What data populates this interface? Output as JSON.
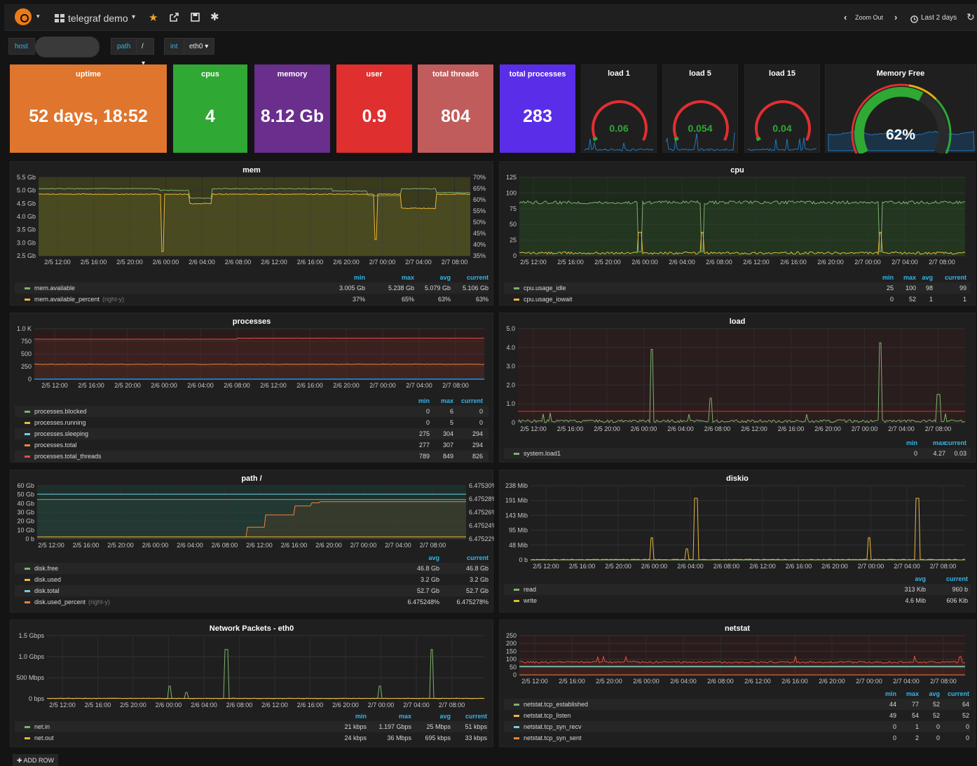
{
  "nav": {
    "dashboard_title": "telegraf demo",
    "zoom_out": "Zoom Out",
    "time_range": "Last 2 days"
  },
  "vars": [
    {
      "label": "host",
      "value": ""
    },
    {
      "label": "path",
      "value": "/"
    },
    {
      "label": "int",
      "value": "eth0"
    }
  ],
  "stats": [
    {
      "title": "uptime",
      "value": "52 days, 18:52",
      "color": "#e0752d"
    },
    {
      "title": "cpus",
      "value": "4",
      "color": "#2fa834"
    },
    {
      "title": "memory",
      "value": "8.12 Gb",
      "color": "#6a2e8c"
    },
    {
      "title": "user",
      "value": "0.9",
      "color": "#e02f2f"
    },
    {
      "title": "total threads",
      "value": "804",
      "color": "#c15c5c"
    },
    {
      "title": "total processes",
      "value": "283",
      "color": "#5a2ee8"
    }
  ],
  "gauges": [
    {
      "title": "load 1",
      "value": "0.06"
    },
    {
      "title": "load 5",
      "value": "0.054"
    },
    {
      "title": "load 15",
      "value": "0.04"
    },
    {
      "title": "Memory Free",
      "value": "62%"
    }
  ],
  "time_ticks": [
    "2/5 12:00",
    "2/5 16:00",
    "2/5 20:00",
    "2/6 00:00",
    "2/6 04:00",
    "2/6 08:00",
    "2/6 12:00",
    "2/6 16:00",
    "2/6 20:00",
    "2/7 00:00",
    "2/7 04:00",
    "2/7 08:00"
  ],
  "mem": {
    "title": "mem",
    "yleft": [
      "5.5 Gb",
      "5.0 Gb",
      "4.5 Gb",
      "4.0 Gb",
      "3.5 Gb",
      "3.0 Gb",
      "2.5 Gb"
    ],
    "yright": [
      "70%",
      "65%",
      "60%",
      "55%",
      "50%",
      "45%",
      "40%",
      "35%"
    ],
    "headers": [
      "min",
      "max",
      "avg",
      "current"
    ],
    "rows": [
      {
        "name": "mem.available",
        "extra": "",
        "color": "#7eb26d",
        "vals": [
          "3.005 Gb",
          "5.238 Gb",
          "5.079 Gb",
          "5.106 Gb"
        ]
      },
      {
        "name": "mem.available_percent",
        "extra": "(right-y)",
        "color": "#eab839",
        "vals": [
          "37%",
          "65%",
          "63%",
          "63%"
        ]
      }
    ]
  },
  "cpu": {
    "title": "cpu",
    "yleft": [
      "125",
      "100",
      "75",
      "50",
      "25",
      "0"
    ],
    "headers": [
      "min",
      "max",
      "avg",
      "current"
    ],
    "rows": [
      {
        "name": "cpu.usage_idle",
        "color": "#7eb26d",
        "vals": [
          "25",
          "100",
          "98",
          "99"
        ]
      },
      {
        "name": "cpu.usage_iowait",
        "color": "#eab839",
        "vals": [
          "0",
          "52",
          "1",
          "1"
        ]
      }
    ]
  },
  "processes": {
    "title": "processes",
    "yleft": [
      "1.0 K",
      "750",
      "500",
      "250",
      "0"
    ],
    "headers": [
      "min",
      "max",
      "current"
    ],
    "rows": [
      {
        "name": "processes.blocked",
        "color": "#7eb26d",
        "vals": [
          "0",
          "6",
          "0"
        ]
      },
      {
        "name": "processes.running",
        "color": "#eab839",
        "vals": [
          "0",
          "5",
          "0"
        ]
      },
      {
        "name": "processes.sleeping",
        "color": "#6ed0e0",
        "vals": [
          "275",
          "304",
          "294"
        ]
      },
      {
        "name": "processes.total",
        "color": "#ef843c",
        "vals": [
          "277",
          "307",
          "294"
        ]
      },
      {
        "name": "processes.total_threads",
        "color": "#e24d42",
        "vals": [
          "789",
          "849",
          "826"
        ]
      }
    ]
  },
  "load": {
    "title": "load",
    "yleft": [
      "5.0",
      "4.0",
      "3.0",
      "2.0",
      "1.0",
      "0"
    ],
    "headers": [
      "min",
      "max",
      "current"
    ],
    "rows": [
      {
        "name": "system.load1",
        "color": "#7eb26d",
        "vals": [
          "0",
          "4.27",
          "0.03"
        ]
      }
    ]
  },
  "path": {
    "title": "path /",
    "yleft": [
      "60 Gb",
      "50 Gb",
      "40 Gb",
      "30 Gb",
      "20 Gb",
      "10 Gb",
      "0 b"
    ],
    "yright": [
      "6.47530%",
      "6.47528%",
      "6.47526%",
      "6.47524%",
      "6.47522%"
    ],
    "headers": [
      "avg",
      "current"
    ],
    "rows": [
      {
        "name": "disk.free",
        "extra": "",
        "color": "#7eb26d",
        "vals": [
          "46.8 Gb",
          "46.8 Gb"
        ]
      },
      {
        "name": "disk.used",
        "extra": "",
        "color": "#eab839",
        "vals": [
          "3.2 Gb",
          "3.2 Gb"
        ]
      },
      {
        "name": "disk.total",
        "extra": "",
        "color": "#6ed0e0",
        "vals": [
          "52.7 Gb",
          "52.7 Gb"
        ]
      },
      {
        "name": "disk.used_percent",
        "extra": "(right-y)",
        "color": "#ef843c",
        "vals": [
          "6.475248%",
          "6.475278%"
        ]
      }
    ]
  },
  "diskio": {
    "title": "diskio",
    "yleft": [
      "238 Mib",
      "191 Mib",
      "143 Mib",
      "95 Mib",
      "48 Mib",
      "0 b"
    ],
    "headers": [
      "avg",
      "current"
    ],
    "rows": [
      {
        "name": "read",
        "color": "#7eb26d",
        "vals": [
          "313 Kib",
          "960 b"
        ]
      },
      {
        "name": "write",
        "color": "#eab839",
        "vals": [
          "4.6 Mib",
          "606 Kib"
        ]
      }
    ]
  },
  "net": {
    "title": "Network Packets - eth0",
    "yleft": [
      "1.5 Gbps",
      "1.0 Gbps",
      "500 Mbps",
      "0 bps"
    ],
    "headers": [
      "min",
      "max",
      "avg",
      "current"
    ],
    "rows": [
      {
        "name": "net.in",
        "color": "#7eb26d",
        "vals": [
          "21 kbps",
          "1.197 Gbps",
          "25 Mbps",
          "51 kbps"
        ]
      },
      {
        "name": "net.out",
        "color": "#eab839",
        "vals": [
          "24 kbps",
          "36 Mbps",
          "695 kbps",
          "33 kbps"
        ]
      }
    ]
  },
  "netstat": {
    "title": "netstat",
    "yleft": [
      "250",
      "200",
      "150",
      "100",
      "50",
      "0"
    ],
    "headers": [
      "min",
      "max",
      "avg",
      "current"
    ],
    "rows": [
      {
        "name": "netstat.tcp_established",
        "color": "#7eb26d",
        "vals": [
          "44",
          "77",
          "52",
          "64"
        ]
      },
      {
        "name": "netstat.tcp_listen",
        "color": "#eab839",
        "vals": [
          "49",
          "54",
          "52",
          "52"
        ]
      },
      {
        "name": "netstat.tcp_syn_recv",
        "color": "#6ed0e0",
        "vals": [
          "0",
          "1",
          "0",
          "0"
        ]
      },
      {
        "name": "netstat.tcp_syn_sent",
        "color": "#ef843c",
        "vals": [
          "0",
          "2",
          "0",
          "0"
        ]
      }
    ]
  },
  "add_row": "ADD ROW"
}
